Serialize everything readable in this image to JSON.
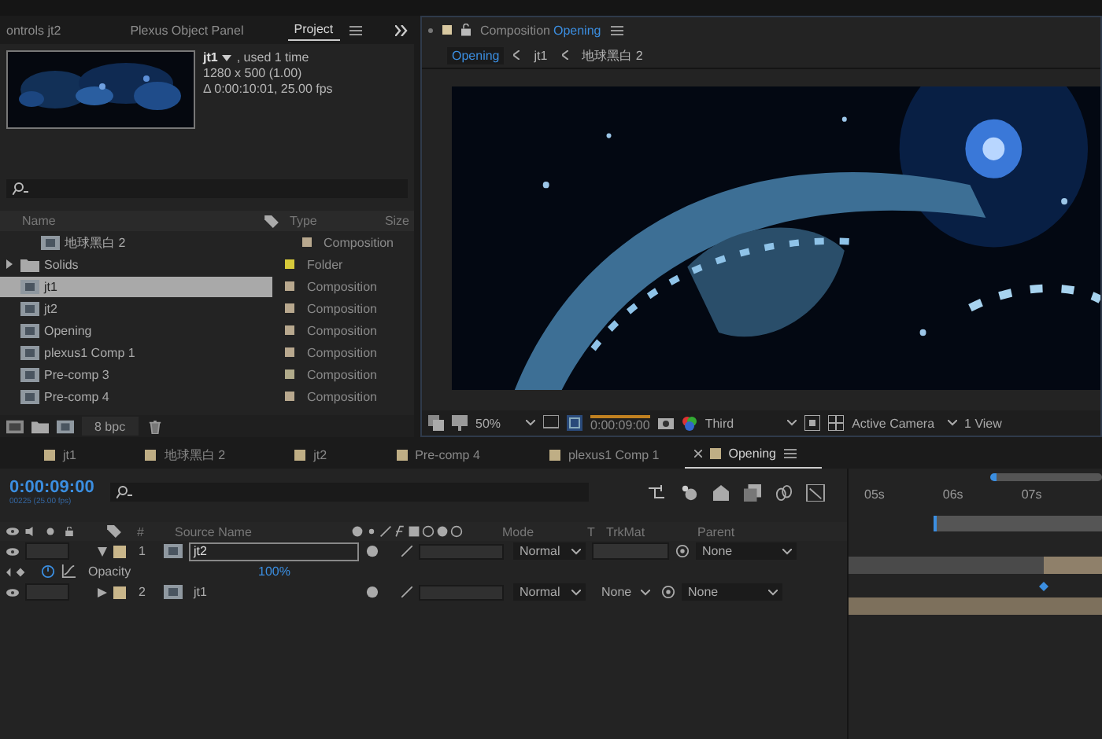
{
  "panel_tabs": [
    {
      "label": "ontrols jt2",
      "selected": false
    },
    {
      "label": "Plexus Object Panel",
      "selected": false
    },
    {
      "label": "Project",
      "selected": true
    }
  ],
  "project": {
    "info": {
      "name": "jt1",
      "usage": ", used 1 time",
      "size": "1280 x 500 (1.00)",
      "duration": "Δ 0:00:10:01, 25.00 fps"
    },
    "columns": {
      "name": "Name",
      "type": "Type",
      "size": "Size"
    },
    "items": [
      {
        "name": "地球黑白 2",
        "kind": "composition",
        "type": "Composition",
        "color": "#b8a88e",
        "selected": false
      },
      {
        "name": "Solids",
        "kind": "folder",
        "type": "Folder",
        "color": "#d6c93a",
        "selected": false
      },
      {
        "name": "jt1",
        "kind": "composition",
        "type": "Composition",
        "color": "#b8a88e",
        "selected": true
      },
      {
        "name": "jt2",
        "kind": "composition",
        "type": "Composition",
        "color": "#b8a88e",
        "selected": false
      },
      {
        "name": "Opening",
        "kind": "composition",
        "type": "Composition",
        "color": "#b8a88e",
        "selected": false
      },
      {
        "name": "plexus1 Comp 1",
        "kind": "composition",
        "type": "Composition",
        "color": "#b8a88e",
        "selected": false
      },
      {
        "name": "Pre-comp 3",
        "kind": "composition",
        "type": "Composition",
        "color": "#b0aa8a",
        "selected": false
      },
      {
        "name": "Pre-comp 4",
        "kind": "composition",
        "type": "Composition",
        "color": "#b8a88e",
        "selected": false
      }
    ],
    "bpc": "8 bpc"
  },
  "composition": {
    "title": "Composition",
    "name": "Opening",
    "breadcrumbs": [
      {
        "label": "Opening",
        "selected": true
      },
      {
        "label": "jt1",
        "selected": false
      },
      {
        "label": "地球黑白 2",
        "selected": false
      }
    ],
    "toolbar": {
      "zoom": "50%",
      "time": "0:00:09:00",
      "resolution": "Third",
      "camera": "Active Camera",
      "views": "1 View"
    }
  },
  "timeline": {
    "tabs": [
      {
        "label": "jt1",
        "selected": false
      },
      {
        "label": "地球黑白 2",
        "selected": false
      },
      {
        "label": "jt2",
        "selected": false
      },
      {
        "label": "Pre-comp 4",
        "selected": false
      },
      {
        "label": "plexus1 Comp 1",
        "selected": false
      },
      {
        "label": "Opening",
        "selected": true
      }
    ],
    "time": "0:00:09:00",
    "frame_info": "00225 (25.00 fps)",
    "columns": {
      "number": "#",
      "source": "Source Name",
      "mode": "Mode",
      "t": "T",
      "trkmat": "TrkMat",
      "parent": "Parent"
    },
    "layers": [
      {
        "number": "1",
        "name": "jt2",
        "expanded": true,
        "selected": true,
        "mode": "Normal",
        "parent": "None",
        "property": {
          "name": "Opacity",
          "value": "100%"
        }
      },
      {
        "number": "2",
        "name": "jt1",
        "expanded": false,
        "selected": false,
        "mode": "Normal",
        "trkmat": "None",
        "parent": "None"
      }
    ],
    "ruler": [
      "05s",
      "06s",
      "07s"
    ]
  }
}
